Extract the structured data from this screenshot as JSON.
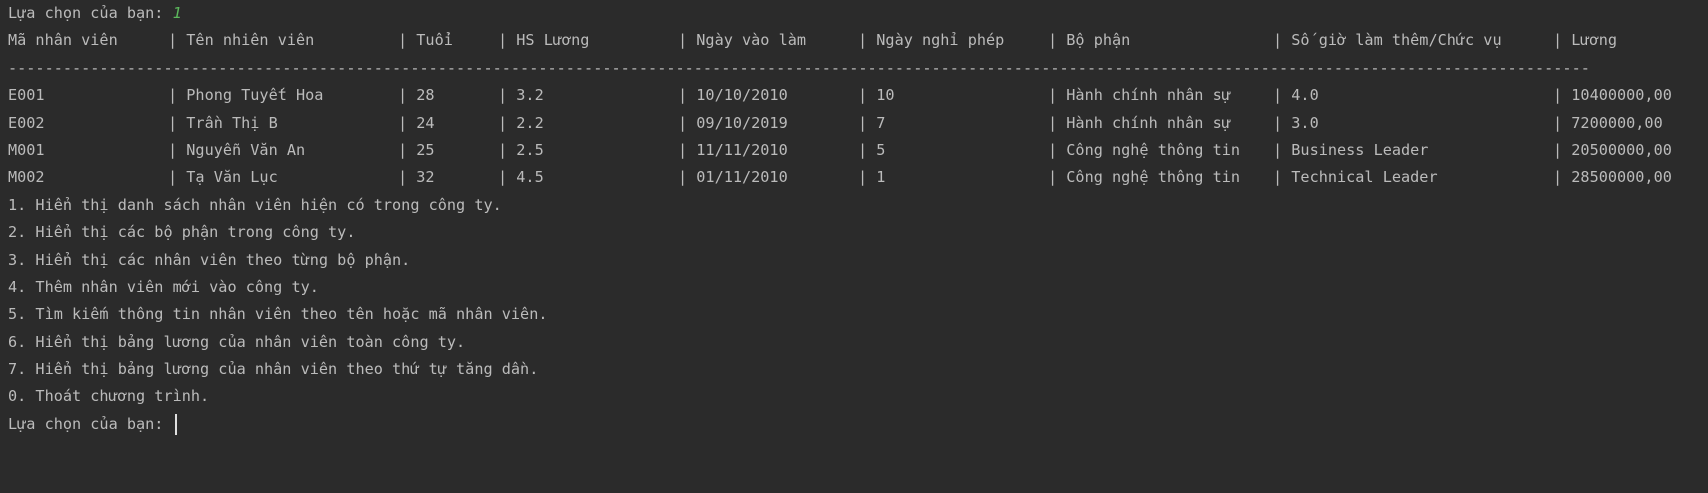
{
  "prompt_top": {
    "label": "Lựa chọn của bạn: ",
    "value": "1"
  },
  "table": {
    "headers": [
      "Mã nhân viên",
      "| Tên nhiên viên",
      "| Tuổi",
      "| HS Lương",
      "| Ngày vào làm",
      "| Ngày nghỉ phép",
      "| Bộ phận",
      "| Số giờ làm thêm/Chức vụ",
      "| Lương"
    ],
    "separator": "-----------------------------------------------------------------------------------------------------------------------------------------------------------------------------",
    "rows": [
      [
        "E001",
        "| Phong Tuyết Hoa",
        "| 28",
        "| 3.2",
        "| 10/10/2010",
        "| 10",
        "| Hành chính nhân sự",
        "| 4.0",
        "| 10400000,00"
      ],
      [
        "E002",
        "| Trần Thị B",
        "| 24",
        "| 2.2",
        "| 09/10/2019",
        "| 7",
        "| Hành chính nhân sự",
        "| 3.0",
        "| 7200000,00"
      ],
      [
        "M001",
        "| Nguyễn Văn An",
        "| 25",
        "| 2.5",
        "| 11/11/2010",
        "| 5",
        "| Công nghệ thông tin",
        "| Business Leader",
        "| 20500000,00"
      ],
      [
        "M002",
        "| Tạ Văn Lục",
        "| 32",
        "| 4.5",
        "| 01/11/2010",
        "| 1",
        "| Công nghệ thông tin",
        "| Technical Leader",
        "| 28500000,00"
      ]
    ]
  },
  "menu": [
    "1. Hiển thị danh sách nhân viên hiện có trong công ty.",
    "2. Hiển thị các bộ phận trong công ty.",
    "3. Hiển thị các nhân viên theo từng bộ phận.",
    "4. Thêm nhân viên mới vào công ty.",
    "5. Tìm kiếm thông tin nhân viên theo tên hoặc mã nhân viên.",
    "6. Hiển thị bảng lương của nhân viên toàn công ty.",
    "7. Hiển thị bảng lương của nhân viên theo thứ tự tăng dần.",
    "0. Thoát chương trình."
  ],
  "prompt_bottom": {
    "label": "Lựa chọn của bạn: "
  }
}
